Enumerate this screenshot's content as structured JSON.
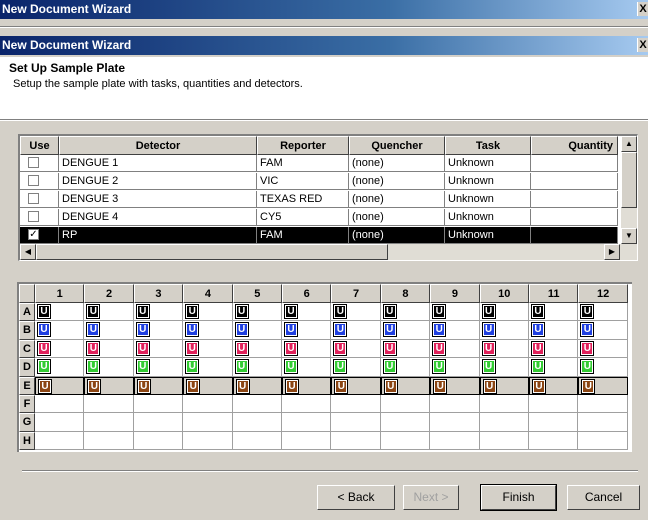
{
  "window_title": "New Document Wizard",
  "dialog_title": "New Document Wizard",
  "close_glyph": "X",
  "header": {
    "title": "Set Up Sample Plate",
    "subtitle": "Setup the sample plate with tasks, quantities and detectors."
  },
  "detector_table": {
    "columns": [
      "Use",
      "Detector",
      "Reporter",
      "Quencher",
      "Task",
      "Quantity"
    ],
    "rows": [
      {
        "use": false,
        "detector": "DENGUE 1",
        "reporter": "FAM",
        "quencher": "(none)",
        "task": "Unknown",
        "quantity": ""
      },
      {
        "use": false,
        "detector": "DENGUE 2",
        "reporter": "VIC",
        "quencher": "(none)",
        "task": "Unknown",
        "quantity": ""
      },
      {
        "use": false,
        "detector": "DENGUE 3",
        "reporter": "TEXAS RED",
        "quencher": "(none)",
        "task": "Unknown",
        "quantity": ""
      },
      {
        "use": false,
        "detector": "DENGUE 4",
        "reporter": "CY5",
        "quencher": "(none)",
        "task": "Unknown",
        "quantity": ""
      },
      {
        "use": true,
        "detector": "RP",
        "reporter": "FAM",
        "quencher": "(none)",
        "task": "Unknown",
        "quantity": "",
        "selected": true
      }
    ],
    "check_glyph": "✓"
  },
  "plate": {
    "columns": [
      "1",
      "2",
      "3",
      "4",
      "5",
      "6",
      "7",
      "8",
      "9",
      "10",
      "11",
      "12"
    ],
    "rows": [
      {
        "label": "A",
        "badge": "U",
        "color": "#000000"
      },
      {
        "label": "B",
        "badge": "U",
        "color": "#1f3fe0"
      },
      {
        "label": "C",
        "badge": "U",
        "color": "#e0205a"
      },
      {
        "label": "D",
        "badge": "U",
        "color": "#33cc33"
      },
      {
        "label": "E",
        "badge": "U",
        "color": "#8b4513",
        "selected": true
      },
      {
        "label": "F",
        "badge": "",
        "color": ""
      },
      {
        "label": "G",
        "badge": "",
        "color": ""
      },
      {
        "label": "H",
        "badge": "",
        "color": ""
      }
    ]
  },
  "buttons": {
    "back": "< Back",
    "next": "Next >",
    "finish": "Finish",
    "cancel": "Cancel"
  }
}
